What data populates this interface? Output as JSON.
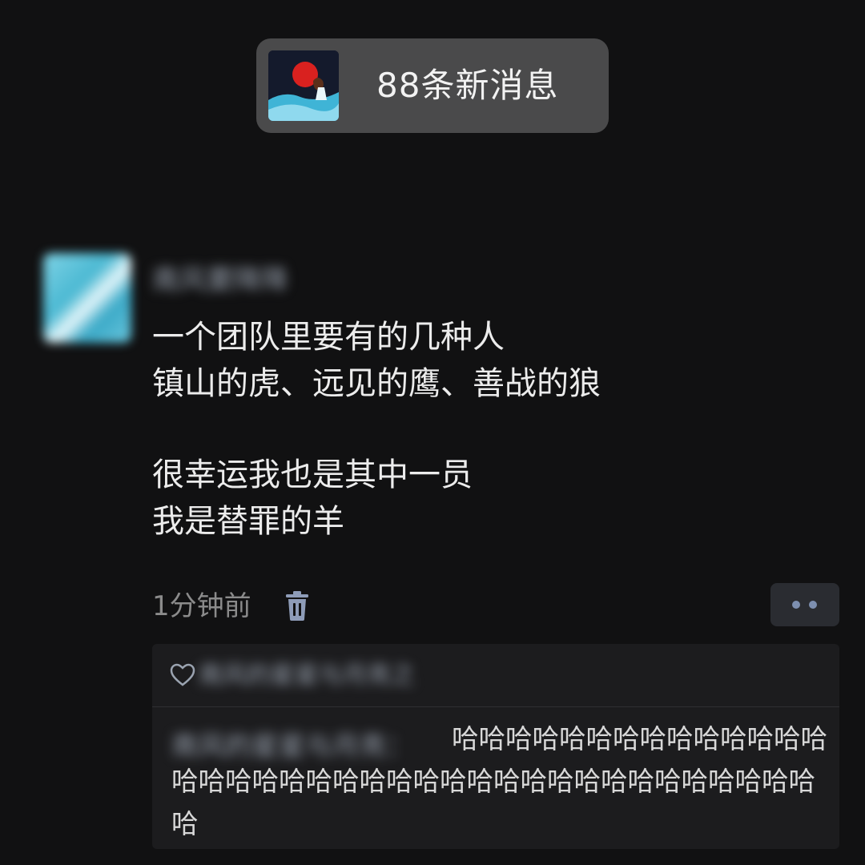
{
  "notification": {
    "text": "88条新消息"
  },
  "post": {
    "author": "南风要降降",
    "lines": [
      "一个团队里要有的几种人",
      "镇山的虎、远见的鹰、善战的狼",
      "很幸运我也是其中一员",
      "我是替罪的羊"
    ],
    "time": "1分钟前"
  },
  "interactions": {
    "likes": "南风的星星与月亮之",
    "comment": {
      "author": "南风的星星与月亮：",
      "text": "哈哈哈哈哈哈哈哈哈哈哈哈哈哈哈哈哈哈哈哈哈哈哈哈哈哈哈哈哈哈哈哈哈哈哈哈哈哈哈"
    }
  },
  "icons": {
    "delete": "trash-icon",
    "more": "more-dots-icon",
    "like": "heart-icon"
  },
  "colors": {
    "background": "#111112",
    "accent_dots": "#7d8fb0",
    "pill": "#4a4a4b"
  }
}
